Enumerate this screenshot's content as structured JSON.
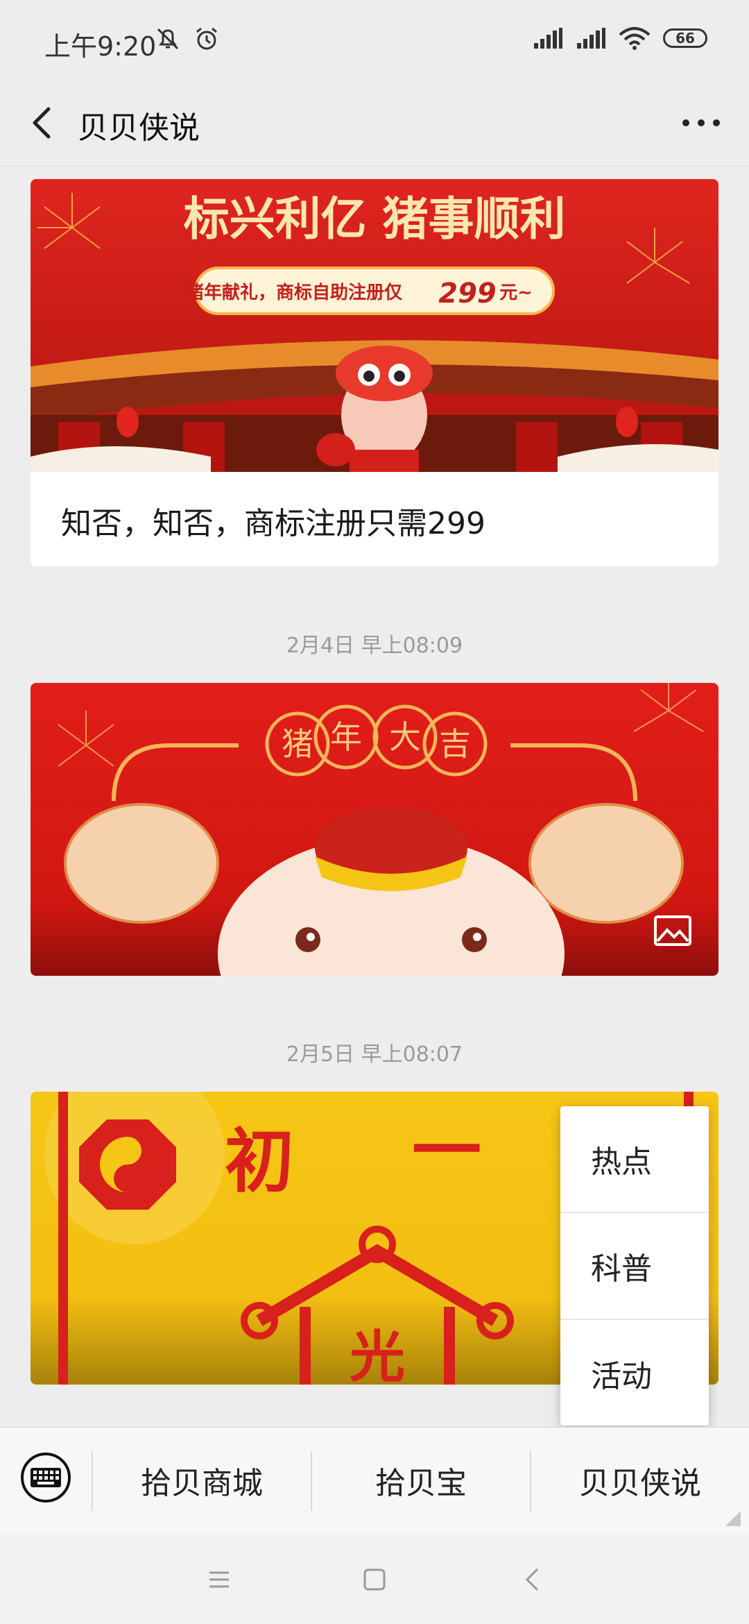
{
  "status_bar": {
    "time": "上午9:20",
    "battery": "66"
  },
  "header": {
    "title": "贝贝侠说"
  },
  "articles": [
    {
      "banner": {
        "headline": "标兴利亿 猪事顺利",
        "subline_prefix": "猪年献礼，商标自助注册仅",
        "price": "299",
        "price_suffix": "元~"
      },
      "caption": "知否，知否，商标注册只需299"
    },
    {
      "timestamp": "2月4日 早上08:09",
      "banner_text": [
        "猪",
        "年",
        "大",
        "吉"
      ]
    },
    {
      "timestamp": "2月5日 早上08:07",
      "banner_text": [
        "初",
        "一",
        "光"
      ]
    }
  ],
  "popup_menu": {
    "items": [
      "热点",
      "科普",
      "活动"
    ]
  },
  "bottom_menu": {
    "items": [
      "拾贝商城",
      "拾贝宝",
      "贝贝侠说"
    ]
  },
  "colors": {
    "red": "#d8201c",
    "yellow": "#f5c515",
    "background": "#ededed"
  }
}
